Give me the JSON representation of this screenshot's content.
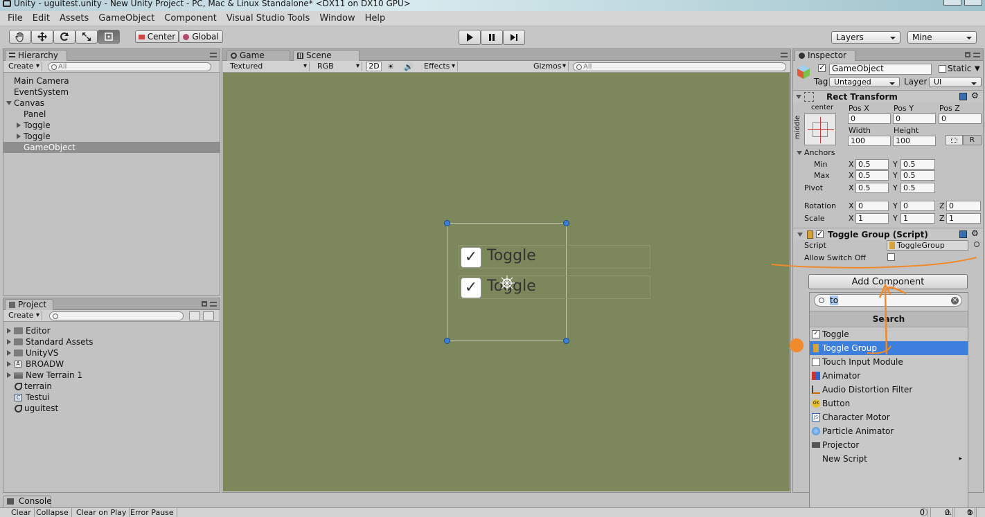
{
  "window": {
    "title": "Unity - uguitest.unity - New Unity Project - PC, Mac & Linux Standalone* <DX11 on DX10 GPU>"
  },
  "menu": [
    "File",
    "Edit",
    "Assets",
    "GameObject",
    "Component",
    "Visual Studio Tools",
    "Window",
    "Help"
  ],
  "toolbar": {
    "center_label": "Center",
    "global_label": "Global",
    "layers": "Layers",
    "layout": "Mine"
  },
  "hierarchy": {
    "tab": "Hierarchy",
    "create": "Create",
    "search_placeholder": "All",
    "items": [
      "Main Camera",
      "EventSystem",
      "Canvas",
      "Panel",
      "Toggle",
      "Toggle",
      "GameObject"
    ]
  },
  "project": {
    "tab": "Project",
    "create": "Create",
    "items": [
      "Editor",
      "Standard Assets",
      "UnityVS",
      "BROADW",
      "New Terrain 1",
      "terrain",
      "Testui",
      "uguitest"
    ]
  },
  "scene": {
    "game_tab": "Game",
    "scene_tab": "Scene",
    "shading": "Textured",
    "rgb": "RGB",
    "mode_2d": "2D",
    "effects": "Effects",
    "gizmos": "Gizmos",
    "search_placeholder": "All",
    "toggles": [
      "Toggle",
      "Toggle"
    ]
  },
  "inspector": {
    "tab": "Inspector",
    "object_name": "GameObject",
    "static_label": "Static",
    "tag_label": "Tag",
    "tag_value": "Untagged",
    "layer_label": "Layer",
    "layer_value": "UI",
    "rect_transform": {
      "title": "Rect Transform",
      "anchor_h": "center",
      "anchor_v": "middle",
      "pos_x_label": "Pos X",
      "pos_y_label": "Pos Y",
      "pos_z_label": "Pos Z",
      "pos_x": "0",
      "pos_y": "0",
      "pos_z": "0",
      "width_label": "Width",
      "height_label": "Height",
      "width": "100",
      "height": "100",
      "raw_button": "R",
      "anchors_label": "Anchors",
      "min_label": "Min",
      "max_label": "Max",
      "pivot_label": "Pivot",
      "rotation_label": "Rotation",
      "scale_label": "Scale",
      "x": "X",
      "y": "Y",
      "z": "Z",
      "min_x": "0.5",
      "min_y": "0.5",
      "max_x": "0.5",
      "max_y": "0.5",
      "pivot_x": "0.5",
      "pivot_y": "0.5",
      "rot_x": "0",
      "rot_y": "0",
      "rot_z": "0",
      "scale_x": "1",
      "scale_y": "1",
      "scale_z": "1"
    },
    "toggle_group": {
      "title": "Toggle Group (Script)",
      "script_label": "Script",
      "script_value": "ToggleGroup",
      "allow_switch_off_label": "Allow Switch Off"
    },
    "add_component": "Add Component"
  },
  "popup": {
    "search_value": "to",
    "header": "Search",
    "items": [
      "Toggle",
      "Toggle Group",
      "Touch Input Module",
      "Animator",
      "Audio Distortion Filter",
      "Button",
      "Character Motor",
      "Particle Animator",
      "Projector",
      "New Script"
    ],
    "selected_index": 1
  },
  "console": {
    "tab": "Console",
    "buttons": [
      "Clear",
      "Collapse",
      "Clear on Play",
      "Error Pause"
    ],
    "counts": [
      "0",
      "0",
      "0"
    ]
  },
  "colors": {
    "scene_bg": "#7d875c",
    "selection": "#3d7fdc",
    "annotation": "#f08a2c"
  }
}
